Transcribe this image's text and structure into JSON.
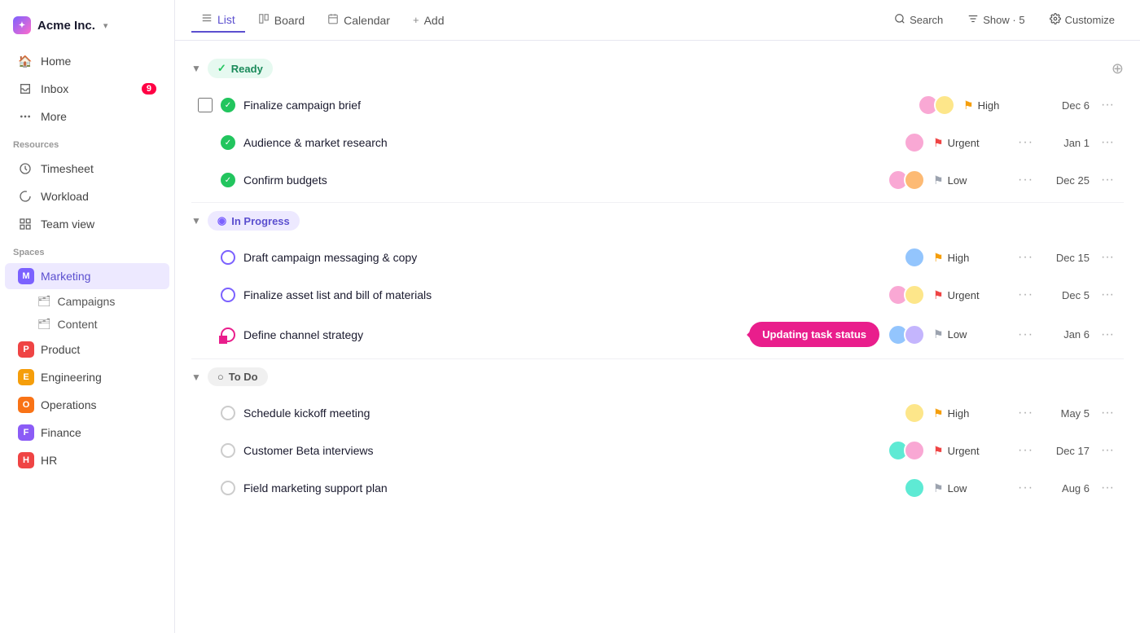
{
  "sidebar": {
    "logo": "Acme Inc.",
    "nav": [
      {
        "id": "home",
        "label": "Home",
        "icon": "🏠"
      },
      {
        "id": "inbox",
        "label": "Inbox",
        "icon": "📥",
        "badge": "9"
      },
      {
        "id": "more",
        "label": "More",
        "icon": "···"
      }
    ],
    "resources_label": "Resources",
    "resources": [
      {
        "id": "timesheet",
        "label": "Timesheet",
        "icon": "⏱"
      },
      {
        "id": "workload",
        "label": "Workload",
        "icon": "↻"
      },
      {
        "id": "teamview",
        "label": "Team view",
        "icon": "⊞"
      }
    ],
    "spaces_label": "Spaces",
    "spaces": [
      {
        "id": "marketing",
        "label": "Marketing",
        "color": "#7b61ff",
        "initial": "M",
        "active": true
      },
      {
        "id": "product",
        "label": "Product",
        "color": "#ef4444",
        "initial": "P"
      },
      {
        "id": "engineering",
        "label": "Engineering",
        "color": "#f59e0b",
        "initial": "E"
      },
      {
        "id": "operations",
        "label": "Operations",
        "color": "#f97316",
        "initial": "O"
      },
      {
        "id": "finance",
        "label": "Finance",
        "color": "#8b5cf6",
        "initial": "F"
      },
      {
        "id": "hr",
        "label": "HR",
        "color": "#ef4444",
        "initial": "H"
      }
    ],
    "marketing_sub": [
      "Campaigns",
      "Content"
    ]
  },
  "topbar": {
    "tabs": [
      {
        "id": "list",
        "label": "List",
        "icon": "≡",
        "active": true
      },
      {
        "id": "board",
        "label": "Board",
        "icon": "⊞"
      },
      {
        "id": "calendar",
        "label": "Calendar",
        "icon": "📅"
      },
      {
        "id": "add",
        "label": "Add",
        "icon": "+"
      }
    ],
    "actions": {
      "search": "Search",
      "show": "Show · 5",
      "customize": "Customize"
    }
  },
  "sections": [
    {
      "id": "ready",
      "label": "Ready",
      "status": "ready",
      "tasks": [
        {
          "id": "t1",
          "name": "Finalize campaign brief",
          "avatars": [
            "av-pink",
            "av-yellow"
          ],
          "priority": "High",
          "priority_color": "#f59e0b",
          "date": "Dec 6",
          "done": true,
          "first": true
        },
        {
          "id": "t2",
          "name": "Audience & market research",
          "avatars": [
            "av-pink"
          ],
          "priority": "Urgent",
          "priority_color": "#ef4444",
          "date": "Jan 1",
          "done": true
        },
        {
          "id": "t3",
          "name": "Confirm budgets",
          "avatars": [
            "av-pink",
            "av-orange"
          ],
          "priority": "Low",
          "priority_color": "#9ca3af",
          "date": "Dec 25",
          "done": true
        }
      ]
    },
    {
      "id": "inprogress",
      "label": "In Progress",
      "status": "inprogress",
      "tasks": [
        {
          "id": "t4",
          "name": "Draft campaign messaging & copy",
          "avatars": [
            "av-blue"
          ],
          "priority": "High",
          "priority_color": "#f59e0b",
          "date": "Dec 15",
          "done": false
        },
        {
          "id": "t5",
          "name": "Finalize asset list and bill of materials",
          "avatars": [
            "av-pink",
            "av-yellow"
          ],
          "priority": "Urgent",
          "priority_color": "#ef4444",
          "date": "Dec 5",
          "done": false
        },
        {
          "id": "t6",
          "name": "Define channel strategy",
          "avatars": [
            "av-blue",
            "av-purple"
          ],
          "priority": "Low",
          "priority_color": "#9ca3af",
          "date": "Jan 6",
          "done": false,
          "updating": true
        }
      ]
    },
    {
      "id": "todo",
      "label": "To Do",
      "status": "todo",
      "tasks": [
        {
          "id": "t7",
          "name": "Schedule kickoff meeting",
          "avatars": [
            "av-yellow"
          ],
          "priority": "High",
          "priority_color": "#f59e0b",
          "date": "May 5",
          "done": false
        },
        {
          "id": "t8",
          "name": "Customer Beta interviews",
          "avatars": [
            "av-teal",
            "av-pink"
          ],
          "priority": "Urgent",
          "priority_color": "#ef4444",
          "date": "Dec 17",
          "done": false
        },
        {
          "id": "t9",
          "name": "Field marketing support plan",
          "avatars": [
            "av-teal"
          ],
          "priority": "Low",
          "priority_color": "#9ca3af",
          "date": "Aug 6",
          "done": false
        }
      ]
    }
  ],
  "tooltip": "Updating task status"
}
